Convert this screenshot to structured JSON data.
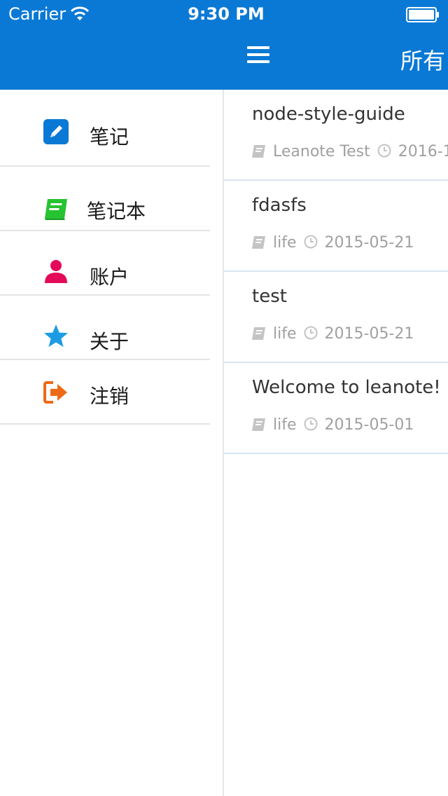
{
  "status_bar": {
    "carrier": "Carrier",
    "time": "9:30 PM"
  },
  "nav": {
    "title": "所有"
  },
  "sidebar": {
    "items": [
      {
        "label": "笔记",
        "icon": "edit-note-icon",
        "color": "#0a79d5"
      },
      {
        "label": "笔记本",
        "icon": "notebook-icon",
        "color": "#27c331"
      },
      {
        "label": "账户",
        "icon": "user-icon",
        "color": "#e5095a"
      },
      {
        "label": "关于",
        "icon": "star-icon",
        "color": "#1d9ce3"
      },
      {
        "label": "注销",
        "icon": "logout-icon",
        "color": "#ee6a16"
      }
    ]
  },
  "notes": [
    {
      "title": "node-style-guide",
      "notebook": "Leanote Test",
      "date": "2016-1"
    },
    {
      "title": "fdasfs",
      "notebook": "life",
      "date": "2015-05-21"
    },
    {
      "title": "test",
      "notebook": "life",
      "date": "2015-05-21"
    },
    {
      "title": "Welcome to leanote!",
      "notebook": "life",
      "date": "2015-05-01"
    }
  ],
  "colors": {
    "header": "#0a79d5",
    "divider": "#d8e6f2",
    "meta_text": "#a0a0a0"
  }
}
